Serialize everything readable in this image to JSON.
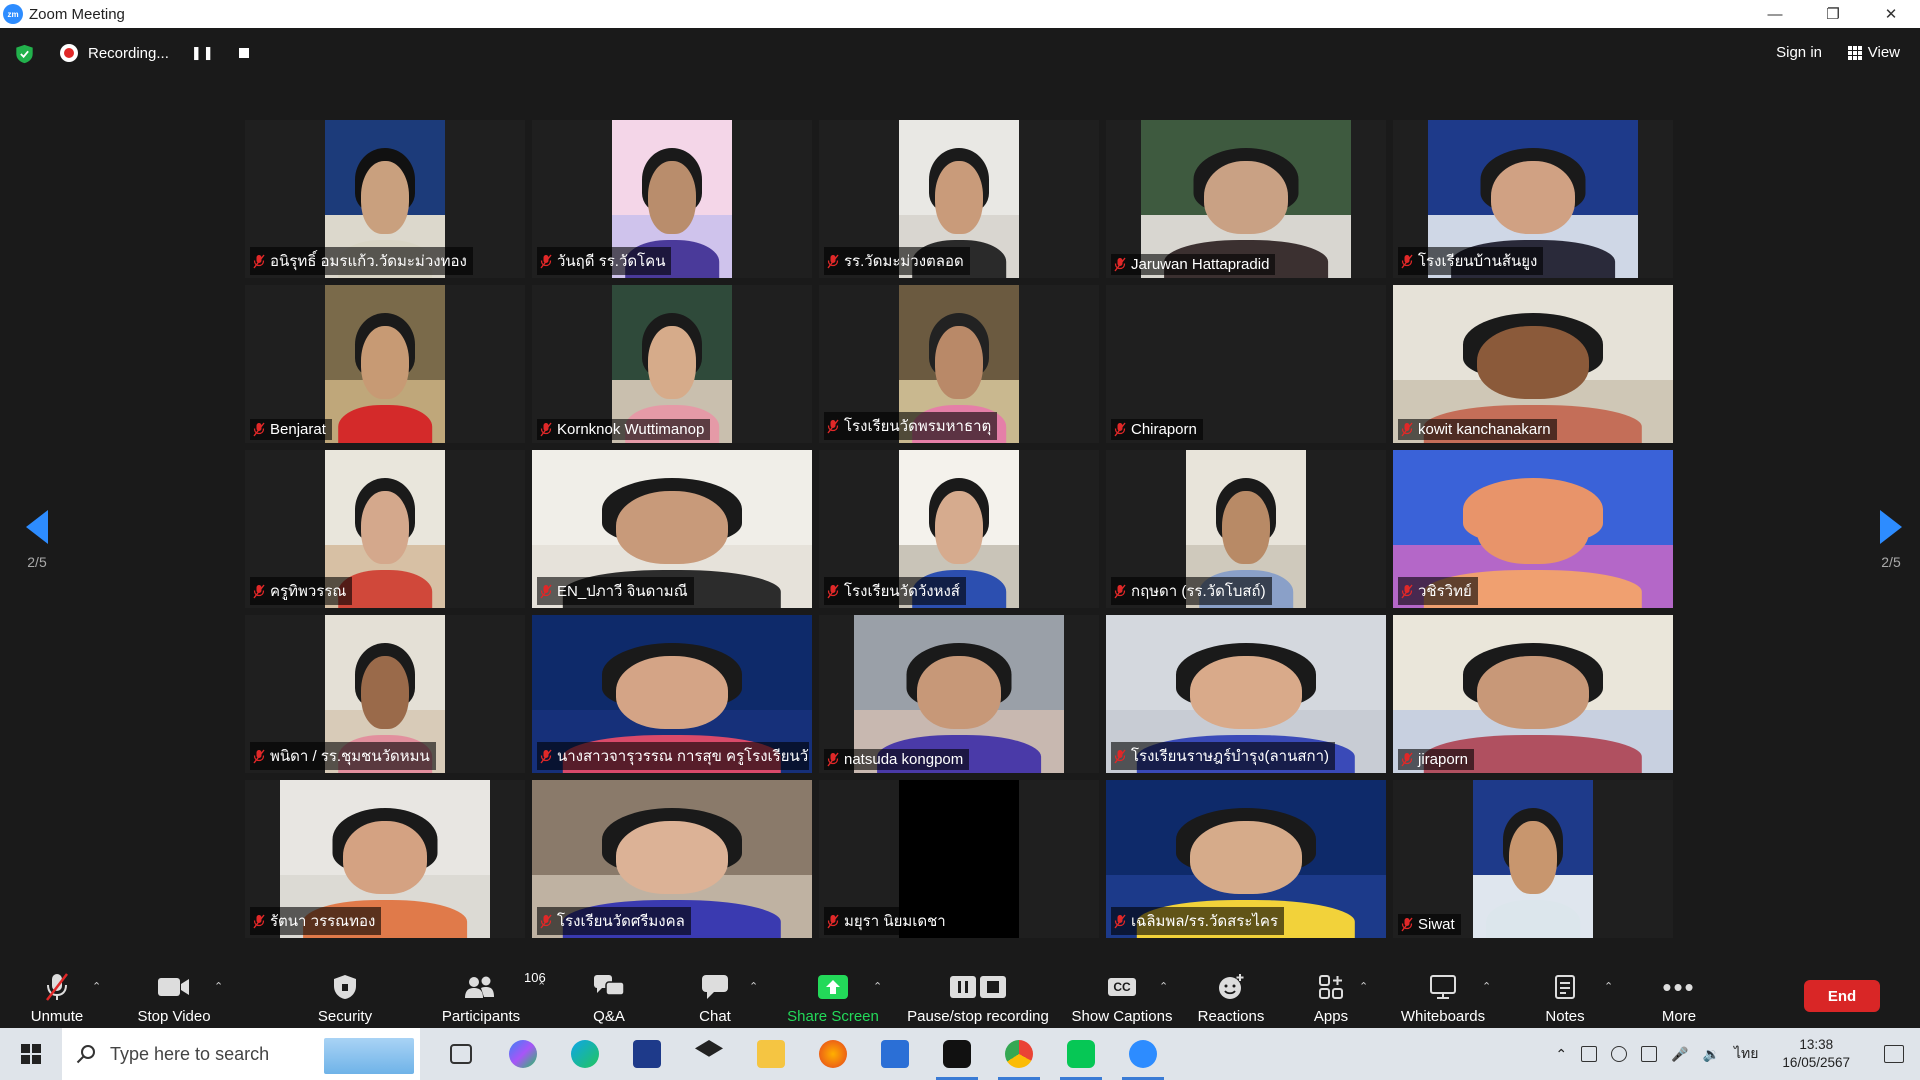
{
  "window": {
    "title": "Zoom Meeting",
    "logo_text": "zm"
  },
  "top_bar": {
    "recording_label": "Recording...",
    "sign_in_label": "Sign in",
    "view_label": "View"
  },
  "pager": {
    "left_text": "2/5",
    "right_text": "2/5"
  },
  "participants": [
    {
      "name": "อนิรุทธิ์ อมรแก้ว.วัดมะม่วงทอง",
      "video": "narrow",
      "colors": [
        "#1c3b7a",
        "#dcd8cc",
        "#c9a07e",
        "#111111",
        "#d9d5c5"
      ]
    },
    {
      "name": "วันฤดี รร.วัดโคน",
      "video": "narrow",
      "colors": [
        "#f4d6e8",
        "#cfc3ec",
        "#b98d6c",
        "#1a1a1a",
        "#4a3a9a"
      ]
    },
    {
      "name": "รร.วัดมะม่วงตลอด",
      "video": "narrow",
      "colors": [
        "#e9e8e4",
        "#d9d6d0",
        "#c99b7a",
        "#1b1b1b",
        "#2a2a2a"
      ]
    },
    {
      "name": "Jaruwan Hattapradid",
      "video": "wide",
      "colors": [
        "#3e5a3f",
        "#d8d6d0",
        "#c9a184",
        "#1a1a1a",
        "#3b3030"
      ]
    },
    {
      "name": "โรงเรียนบ้านส้นยูง",
      "video": "wide",
      "colors": [
        "#1e3a8a",
        "#cfd7e6",
        "#d0a183",
        "#1a1a1a",
        "#2a2a3a"
      ]
    },
    {
      "name": "Benjarat",
      "video": "narrow",
      "colors": [
        "#7a6a4a",
        "#bfa77a",
        "#c79a74",
        "#1a1a1a",
        "#d42a2a"
      ]
    },
    {
      "name": "Kornknok Wuttimanop",
      "video": "narrow",
      "colors": [
        "#2f4a3a",
        "#c9bfae",
        "#d6ab8a",
        "#1a1a1a",
        "#e59aa7"
      ]
    },
    {
      "name": "โรงเรียนวัดพรมหาธาตุ",
      "video": "narrow",
      "colors": [
        "#6b5a40",
        "#c9b88f",
        "#b98968",
        "#222222",
        "#e57fa8"
      ]
    },
    {
      "name": "Chiraporn",
      "video": "none",
      "colors": [
        "#000000",
        "#000000",
        "#000000",
        "#000000",
        "#000000"
      ]
    },
    {
      "name": "kowit kanchanakarn",
      "video": "full",
      "colors": [
        "#e6e2d8",
        "#cfc7b6",
        "#8b5a3a",
        "#1a1a1a",
        "#c46e58"
      ]
    },
    {
      "name": "ครูทิพวรรณ",
      "video": "narrow",
      "colors": [
        "#e9e6dc",
        "#d7c0a4",
        "#d4a88c",
        "#1a1a1a",
        "#d0483a"
      ]
    },
    {
      "name": "EN_ปภาวี จินดามณี",
      "video": "full",
      "colors": [
        "#f0eee8",
        "#e6e2da",
        "#c89a7a",
        "#1a1a1a",
        "#2c2c2c"
      ]
    },
    {
      "name": "โรงเรียนวัดวังหงส์",
      "video": "narrow",
      "colors": [
        "#f4f2ec",
        "#c9c4b8",
        "#d6ab8e",
        "#1a1a1a",
        "#2c4fb0"
      ]
    },
    {
      "name": "กฤษดา (รร.วัดโบสถ์)",
      "video": "narrow",
      "colors": [
        "#e8e4da",
        "#cfc9bc",
        "#b88a66",
        "#1a1a1a",
        "#8aa0c8"
      ]
    },
    {
      "name": "วชิรวิทย์",
      "video": "full",
      "colors": [
        "#3a62d8",
        "#b467c8",
        "#e8946a",
        "#e8946a",
        "#f0a070"
      ]
    },
    {
      "name": "พนิดา / รร.ชุมชนวัดหมน",
      "video": "narrow",
      "colors": [
        "#e4e0d6",
        "#d8cbb8",
        "#9a6a4a",
        "#1a1a1a",
        "#e2909e"
      ]
    },
    {
      "name": "นางสาวจารุวรรณ การสุข ครูโรงเรียนวั...",
      "video": "full",
      "colors": [
        "#0e2a6a",
        "#16307a",
        "#d4a486",
        "#1a1a1a",
        "#d94a6a"
      ]
    },
    {
      "name": "natsuda kongpom",
      "video": "wide",
      "colors": [
        "#9aa0a8",
        "#c8b8b0",
        "#c79878",
        "#1a1a1a",
        "#4a3aa8"
      ]
    },
    {
      "name": "โรงเรียนราษฎร์บำรุง(ลานสกา)",
      "video": "full",
      "colors": [
        "#d4d8de",
        "#c8ccd4",
        "#d9aa8a",
        "#1a1a1a",
        "#3a4ab8"
      ]
    },
    {
      "name": "jiraporn",
      "video": "full",
      "colors": [
        "#eae6da",
        "#c8d0e0",
        "#c89878",
        "#1a1a1a",
        "#b05060"
      ]
    },
    {
      "name": "รัตนา วรรณทอง",
      "video": "wide",
      "colors": [
        "#e8e6e2",
        "#dcdad4",
        "#d4a282",
        "#1a1a1a",
        "#e07a4a"
      ]
    },
    {
      "name": "โรงเรียนวัดศรีมงคล",
      "video": "full",
      "colors": [
        "#8a7a6a",
        "#bfb2a2",
        "#dcb296",
        "#1a1a1a",
        "#3a3ab0"
      ]
    },
    {
      "name": "มยุรา นิยมเดชา",
      "video": "narrow",
      "colors": [
        "#000000",
        "#000000",
        "#000000",
        "#000000",
        "#000000"
      ]
    },
    {
      "name": "เฉลิมพล/รร.วัดสระไคร",
      "video": "full",
      "colors": [
        "#0e2a6a",
        "#1c3a8a",
        "#d6ab8a",
        "#1a1a1a",
        "#f2d23a"
      ]
    },
    {
      "name": "Siwat",
      "video": "narrow",
      "colors": [
        "#1e3a8a",
        "#dfe6ee",
        "#c8966e",
        "#1a1a1a",
        "#dce6ec"
      ]
    }
  ],
  "toolbar": {
    "unmute": "Unmute",
    "stop_video": "Stop Video",
    "security": "Security",
    "participants": "Participants",
    "participants_count": "106",
    "qa": "Q&A",
    "chat": "Chat",
    "share_screen": "Share Screen",
    "pause_recording": "Pause/stop recording",
    "show_captions": "Show Captions",
    "captions_icon_text": "CC",
    "reactions": "Reactions",
    "apps": "Apps",
    "whiteboards": "Whiteboards",
    "notes": "Notes",
    "more": "More",
    "end": "End",
    "share_color": "#23d959",
    "end_color": "#d92626"
  },
  "taskbar": {
    "search_placeholder": "Type here to search",
    "time": "13:38",
    "date": "16/05/2567",
    "language": "ไทย",
    "apps": [
      "task-view",
      "copilot",
      "edge",
      "store",
      "dropbox",
      "file-explorer",
      "firefox",
      "mail",
      "webex",
      "chrome",
      "line",
      "zoom"
    ]
  }
}
